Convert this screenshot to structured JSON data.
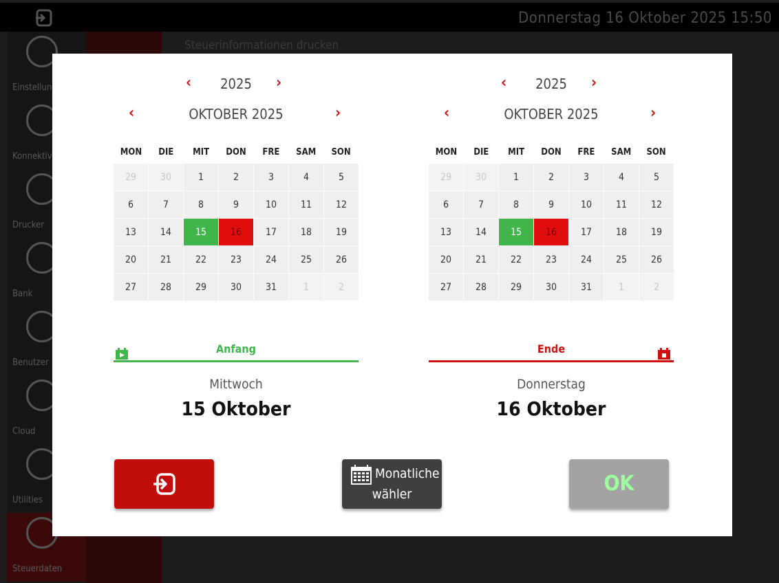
{
  "app": {
    "datetime": "Donnerstag 16 Oktober 2025  15:50",
    "background_title": "Steuerinformationen drucken",
    "sidebar": [
      {
        "label": "Einstellungen"
      },
      {
        "label": "Konnektivität"
      },
      {
        "label": "Drucker"
      },
      {
        "label": "Bank"
      },
      {
        "label": "Benutzer"
      },
      {
        "label": "Cloud"
      },
      {
        "label": "Utilities"
      },
      {
        "label": "Steuerdaten"
      }
    ]
  },
  "weekdays": [
    "MON",
    "DIE",
    "MIT",
    "DON",
    "FRE",
    "SAM",
    "SON"
  ],
  "start_calendar": {
    "year": "2025",
    "month": "OKTOBER 2025",
    "prev_symbol": "‹",
    "next_symbol": "›",
    "days": [
      "29",
      "30",
      "1",
      "2",
      "3",
      "4",
      "5",
      "6",
      "7",
      "8",
      "9",
      "10",
      "11",
      "12",
      "13",
      "14",
      "15",
      "16",
      "17",
      "18",
      "19",
      "20",
      "21",
      "22",
      "23",
      "24",
      "25",
      "26",
      "27",
      "28",
      "29",
      "30",
      "31",
      "1",
      "2"
    ],
    "range_label": "Anfang",
    "weekday_name": "Mittwoch",
    "date_text": "15 Oktober"
  },
  "end_calendar": {
    "year": "2025",
    "month": "OKTOBER 2025",
    "prev_symbol": "‹",
    "next_symbol": "›",
    "days": [
      "29",
      "30",
      "1",
      "2",
      "3",
      "4",
      "5",
      "6",
      "7",
      "8",
      "9",
      "10",
      "11",
      "12",
      "13",
      "14",
      "15",
      "16",
      "17",
      "18",
      "19",
      "20",
      "21",
      "22",
      "23",
      "24",
      "25",
      "26",
      "27",
      "28",
      "29",
      "30",
      "31",
      "1",
      "2"
    ],
    "range_label": "Ende",
    "weekday_name": "Donnerstag",
    "date_text": "16 Oktober"
  },
  "buttons": {
    "monthly_line1": "Monatliche",
    "monthly_line2": "wähler",
    "ok": "OK"
  },
  "colors": {
    "accent_red": "#d01010",
    "start_green": "#3fb54a",
    "end_red": "#e00e0e",
    "ok_text": "#9dff9d"
  }
}
